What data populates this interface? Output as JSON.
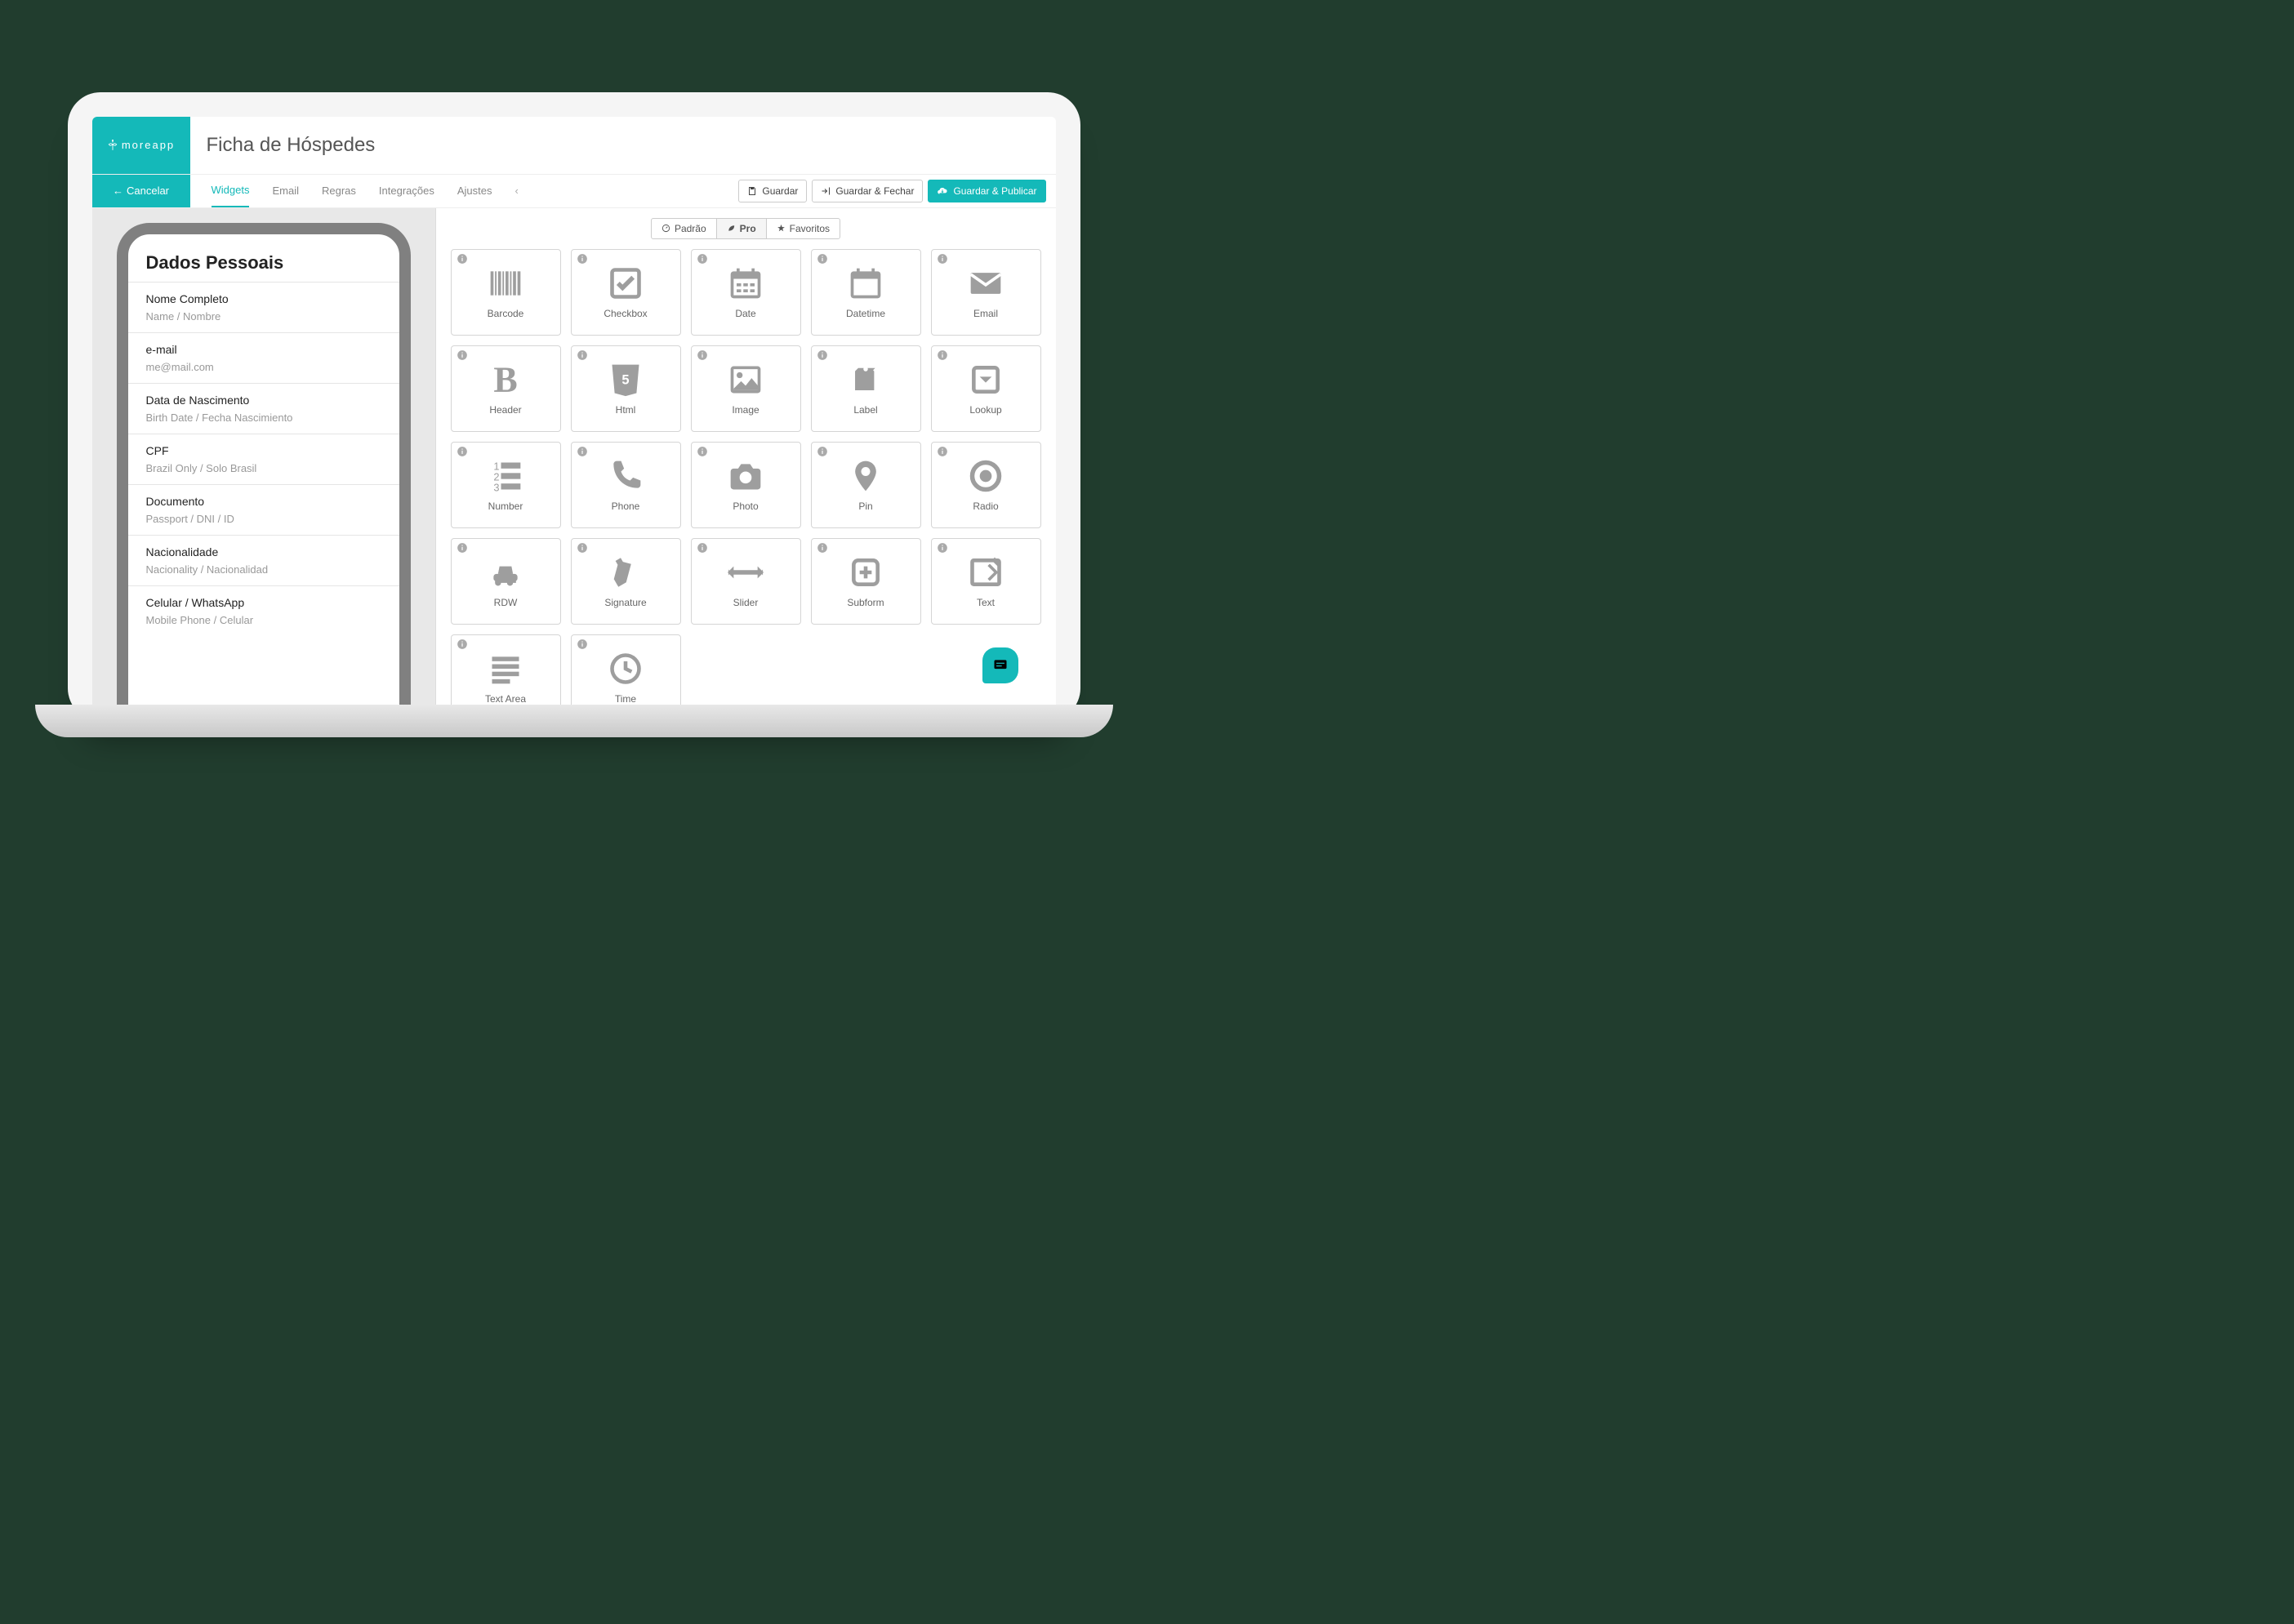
{
  "brand": "moreapp",
  "title": "Ficha de Hóspedes",
  "cancel": "Cancelar",
  "tabs": [
    "Widgets",
    "Email",
    "Regras",
    "Integrações",
    "Ajustes"
  ],
  "tabs_active": 0,
  "actions": {
    "save": "Guardar",
    "save_close": "Guardar & Fechar",
    "save_publish": "Guardar & Publicar"
  },
  "preview": {
    "section": "Dados Pessoais",
    "fields": [
      {
        "label": "Nome Completo",
        "ph": "Name / Nombre"
      },
      {
        "label": "e-mail",
        "ph": "me@mail.com"
      },
      {
        "label": "Data de Nascimento",
        "ph": "Birth Date / Fecha Nascimiento"
      },
      {
        "label": "CPF",
        "ph": "Brazil Only / Solo Brasil"
      },
      {
        "label": "Documento",
        "ph": "Passport / DNI / ID"
      },
      {
        "label": "Nacionalidade",
        "ph": "Nacionality / Nacionalidad"
      },
      {
        "label": "Celular / WhatsApp",
        "ph": "Mobile Phone / Celular"
      }
    ]
  },
  "filters": [
    "Padrão",
    "Pro",
    "Favoritos"
  ],
  "filters_active": 1,
  "widgets": [
    {
      "name": "Barcode",
      "icon": "barcode"
    },
    {
      "name": "Checkbox",
      "icon": "checkbox"
    },
    {
      "name": "Date",
      "icon": "date"
    },
    {
      "name": "Datetime",
      "icon": "datetime"
    },
    {
      "name": "Email",
      "icon": "email"
    },
    {
      "name": "Header",
      "icon": "header"
    },
    {
      "name": "Html",
      "icon": "html"
    },
    {
      "name": "Image",
      "icon": "image"
    },
    {
      "name": "Label",
      "icon": "label"
    },
    {
      "name": "Lookup",
      "icon": "lookup"
    },
    {
      "name": "Number",
      "icon": "number"
    },
    {
      "name": "Phone",
      "icon": "phone"
    },
    {
      "name": "Photo",
      "icon": "photo"
    },
    {
      "name": "Pin",
      "icon": "pin"
    },
    {
      "name": "Radio",
      "icon": "radio"
    },
    {
      "name": "RDW",
      "icon": "rdw"
    },
    {
      "name": "Signature",
      "icon": "signature"
    },
    {
      "name": "Slider",
      "icon": "slider"
    },
    {
      "name": "Subform",
      "icon": "subform"
    },
    {
      "name": "Text",
      "icon": "text"
    },
    {
      "name": "Text Area",
      "icon": "textarea"
    },
    {
      "name": "Time",
      "icon": "time"
    }
  ]
}
